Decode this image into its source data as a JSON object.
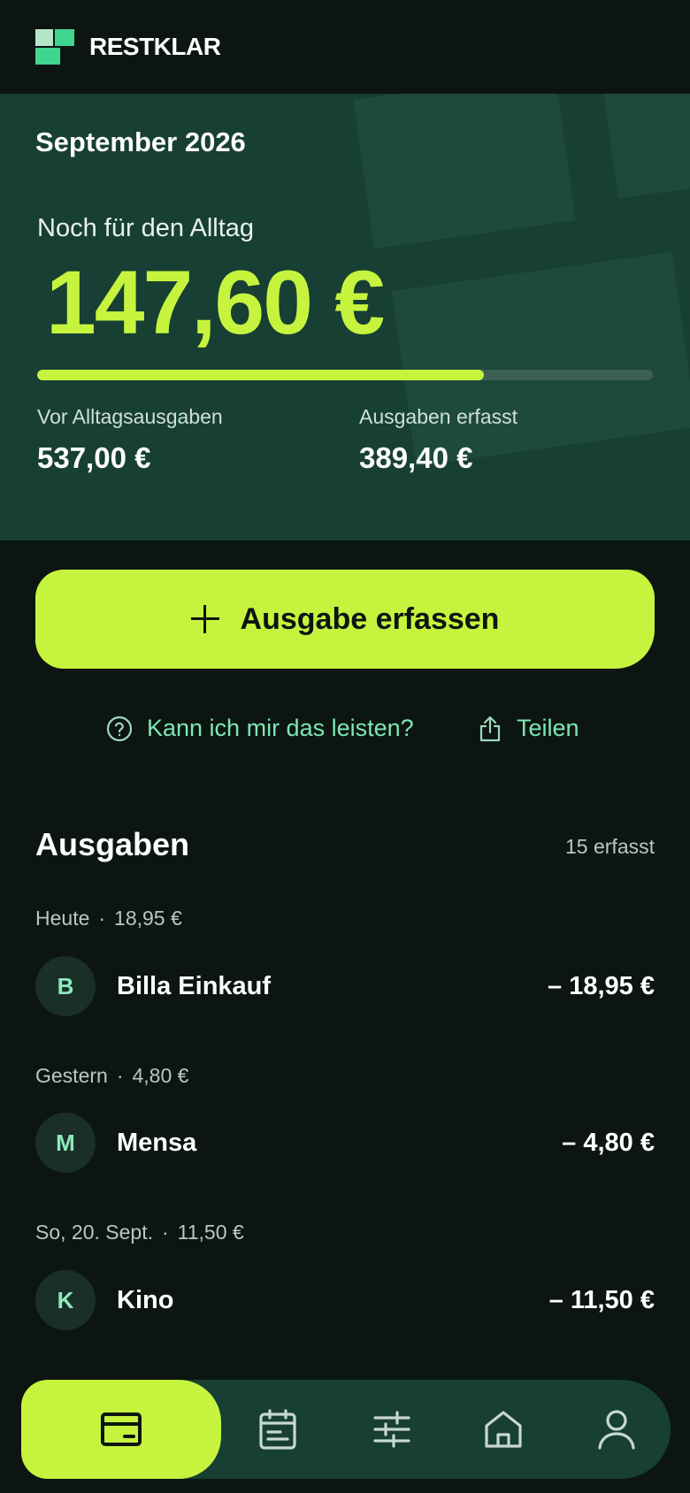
{
  "app": {
    "brand": "RESTKLAR"
  },
  "hero": {
    "date": "September 2026",
    "label": "Noch für den Alltag",
    "amount": "147,60 €",
    "progress": 0.725,
    "stats": [
      {
        "label": "Vor Alltagsausgaben",
        "value": "537,00 €"
      },
      {
        "label": "Ausgaben erfasst",
        "value": "389,40 €"
      }
    ]
  },
  "actions": {
    "add_label": "Ausgabe erfassen",
    "afford_label": "Kann ich mir das leisten?",
    "share_label": "Teilen"
  },
  "expenses": {
    "title": "Ausgaben",
    "count": "15 erfasst",
    "groups": [
      {
        "day": "Heute",
        "sep": "·",
        "total": "18,95 €",
        "items": [
          {
            "initial": "B",
            "name": "Billa Einkauf",
            "amount": "– 18,95 €"
          }
        ]
      },
      {
        "day": "Gestern",
        "sep": "·",
        "total": "4,80 €",
        "items": [
          {
            "initial": "M",
            "name": "Mensa",
            "amount": "– 4,80 €"
          }
        ]
      },
      {
        "day": "So, 20. Sept.",
        "sep": "·",
        "total": "11,50 €",
        "items": [
          {
            "initial": "K",
            "name": "Kino",
            "amount": "– 11,50 €"
          }
        ]
      }
    ]
  },
  "nav": {
    "items": [
      {
        "icon": "wallet-icon",
        "active": true
      },
      {
        "icon": "calendar-icon",
        "active": false
      },
      {
        "icon": "sliders-icon",
        "active": false
      },
      {
        "icon": "home-icon",
        "active": false
      },
      {
        "icon": "user-icon",
        "active": false
      }
    ]
  },
  "colors": {
    "accent": "#c6f43e",
    "background": "#0c1512",
    "hero": "#173f33",
    "link": "#7ee8b4"
  }
}
